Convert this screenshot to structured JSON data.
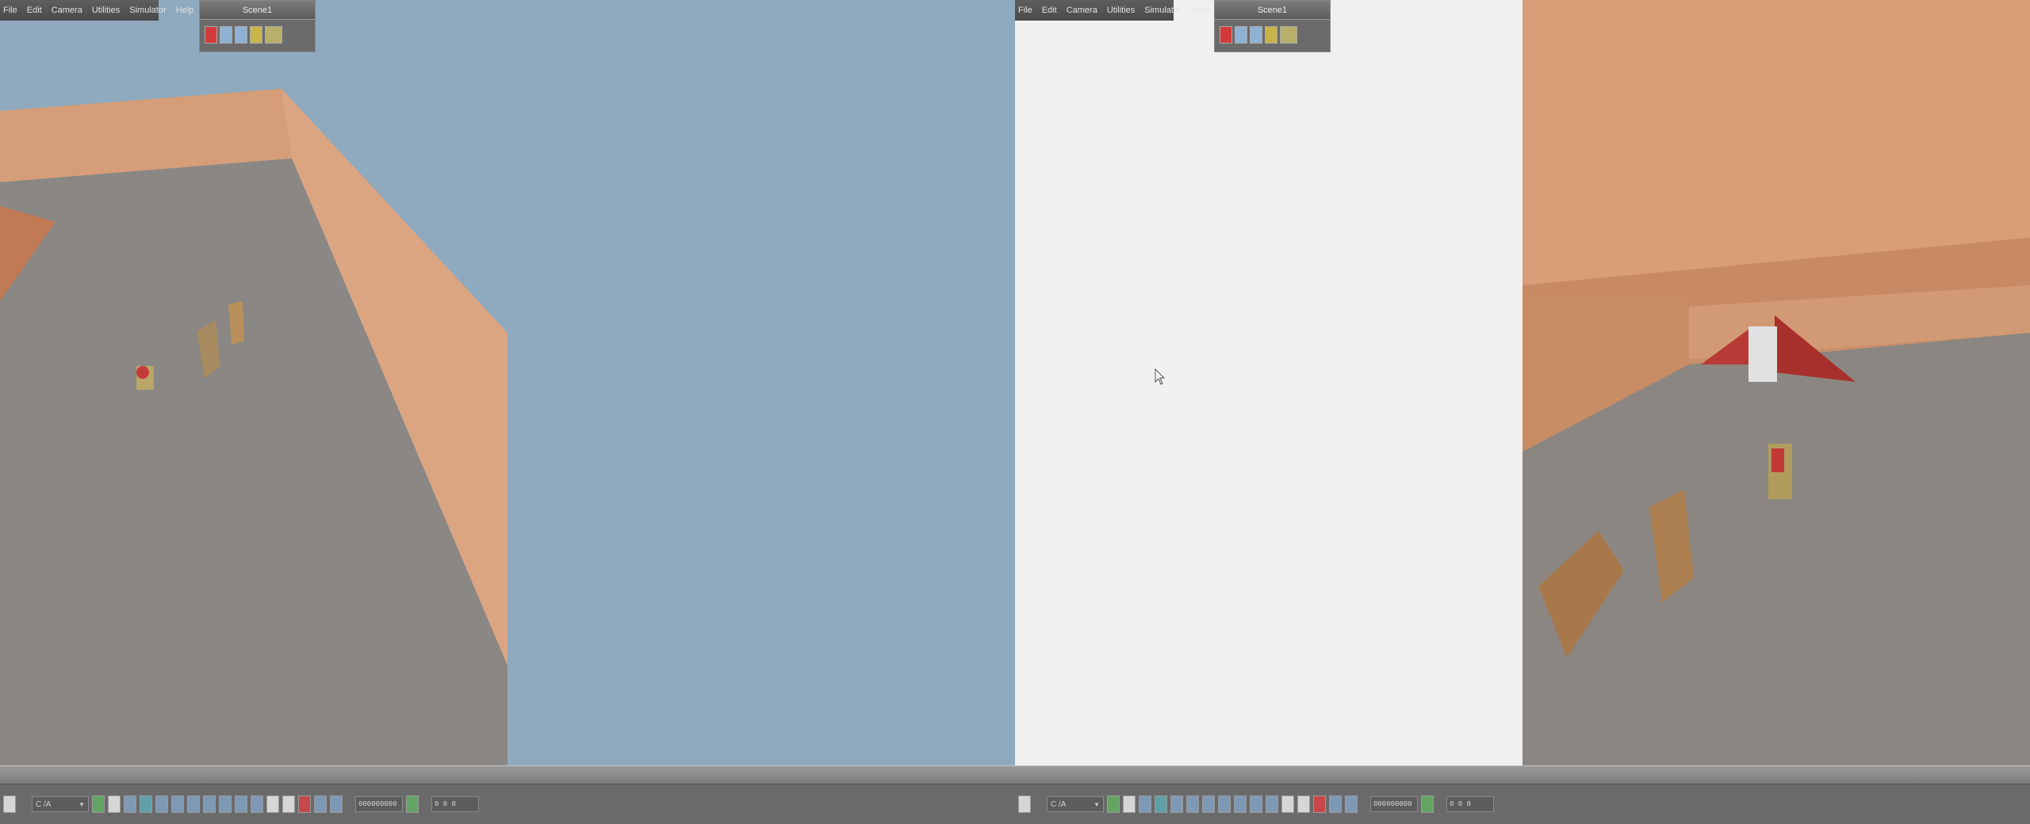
{
  "menu": {
    "items": [
      {
        "label": "File"
      },
      {
        "label": "Edit"
      },
      {
        "label": "Camera"
      },
      {
        "label": "Utilities"
      },
      {
        "label": "Simulator"
      },
      {
        "label": "Help"
      }
    ]
  },
  "scene": {
    "tab_label": "Scene1"
  },
  "toolbar": {
    "mode_select": "C /A",
    "coordinate_value": "000000000",
    "time_value": "0 0 0"
  },
  "colors": {
    "sky": "#8fa9bf",
    "floor": "#8a8784",
    "wall": "#d9a27a",
    "viewport_blank": "#f0f0f0",
    "ramp_red": "#b83a36"
  }
}
